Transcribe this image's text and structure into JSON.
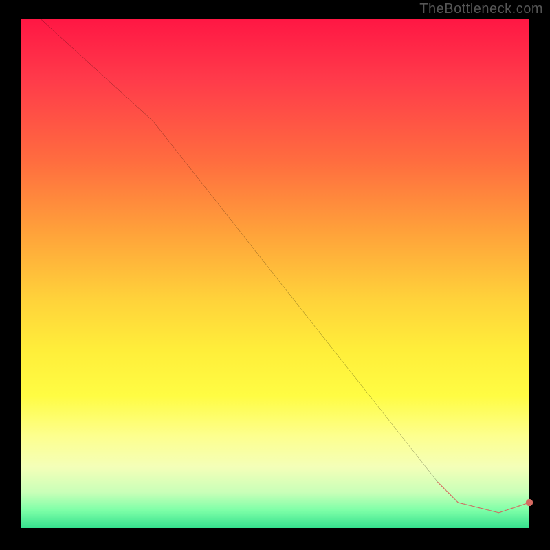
{
  "watermark": "TheBottleneck.com",
  "chart_data": {
    "type": "line",
    "title": "",
    "xlabel": "",
    "ylabel": "",
    "xlim": [
      0,
      100
    ],
    "ylim": [
      0,
      100
    ],
    "grid": false,
    "legend": false,
    "series": [
      {
        "name": "main-curve",
        "style": "solid-black",
        "x": [
          4,
          26,
          82,
          86,
          94,
          100
        ],
        "y": [
          100,
          80,
          9,
          5,
          3,
          5
        ]
      },
      {
        "name": "highlight-segment",
        "style": "thick-dashed-red",
        "x": [
          82,
          86,
          94,
          100
        ],
        "y": [
          9,
          5,
          3,
          5
        ]
      }
    ],
    "annotations": []
  },
  "colors": {
    "curve": "#000000",
    "highlight": "#d66a61",
    "endpoint_dot": "#d66a61"
  }
}
